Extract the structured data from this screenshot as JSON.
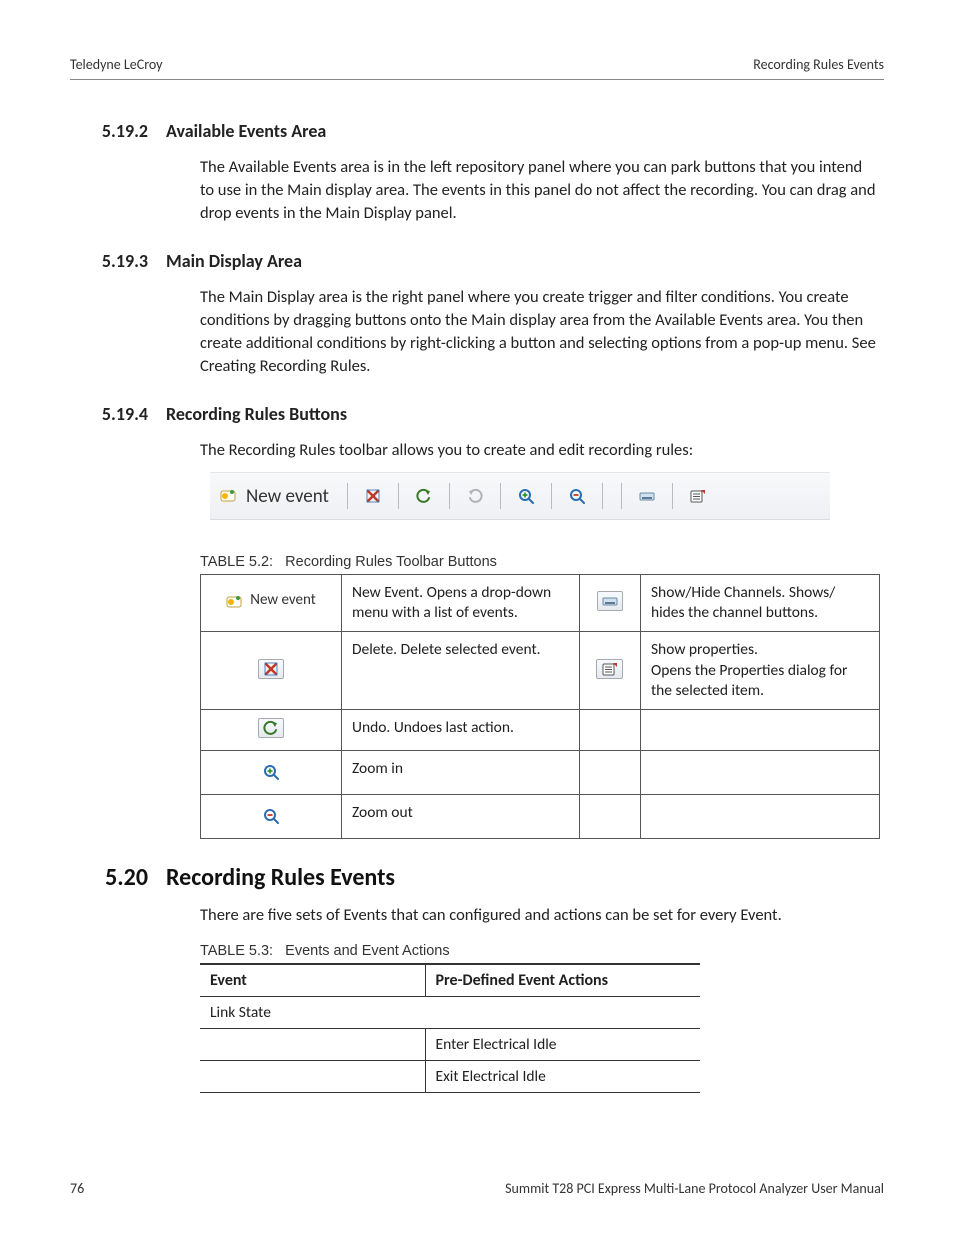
{
  "header": {
    "left": "Teledyne LeCroy",
    "right": "Recording Rules Events"
  },
  "sections": {
    "s1": {
      "num": "5.19.2",
      "title": "Available Events Area",
      "body": "The Available Events area is in the left repository panel where you can park buttons that you intend to use in the Main display area. The events in this panel do not affect the recording. You can drag and drop events in the Main Display panel."
    },
    "s2": {
      "num": "5.19.3",
      "title": "Main Display Area",
      "body": "The Main Display area is the right panel where you create trigger and filter conditions. You create conditions by dragging buttons onto the Main display area from the Available Events area. You then create additional conditions by right-clicking a button and selecting options from a pop-up menu. See Creating Recording Rules."
    },
    "s3": {
      "num": "5.19.4",
      "title": "Recording Rules Buttons",
      "body": "The Recording Rules toolbar allows you to create and edit recording rules:"
    }
  },
  "toolbar_strip": {
    "new_event_label": "New event"
  },
  "table52": {
    "caption_label": "TABLE 5.2:",
    "caption_text": "Recording Rules Toolbar Buttons",
    "rows": [
      {
        "left_icon": "new-event",
        "left_text": "New Event. Opens a drop-down menu with a list of events.",
        "right_icon": "channels",
        "right_text": "Show/Hide Channels. Shows/ hides the channel buttons."
      },
      {
        "left_icon": "delete",
        "left_text": "Delete. Delete selected event.",
        "right_icon": "properties",
        "right_text": "Show properties.\nOpens the Properties dialog for the selected item."
      },
      {
        "left_icon": "undo",
        "left_text": "Undo. Undoes last action.",
        "right_icon": "",
        "right_text": ""
      },
      {
        "left_icon": "zoom-in",
        "left_text": "Zoom in",
        "right_icon": "",
        "right_text": ""
      },
      {
        "left_icon": "zoom-out",
        "left_text": "Zoom out",
        "right_icon": "",
        "right_text": ""
      }
    ]
  },
  "section520": {
    "num": "5.20",
    "title": "Recording Rules Events",
    "body": "There are five sets of Events that can configured and actions can be set for every Event."
  },
  "table53": {
    "caption_label": "TABLE 5.3:",
    "caption_text": "Events and Event Actions",
    "head": {
      "c1": "Event",
      "c2": "Pre-Defined Event Actions"
    },
    "rows": [
      {
        "span": true,
        "c1": "Link State"
      },
      {
        "c1": "",
        "c2": "Enter Electrical Idle"
      },
      {
        "c1": "",
        "c2": "Exit Electrical Idle"
      }
    ]
  },
  "footer": {
    "page": "76",
    "manual": "Summit T28 PCI Express Multi-Lane Protocol Analyzer User Manual"
  }
}
